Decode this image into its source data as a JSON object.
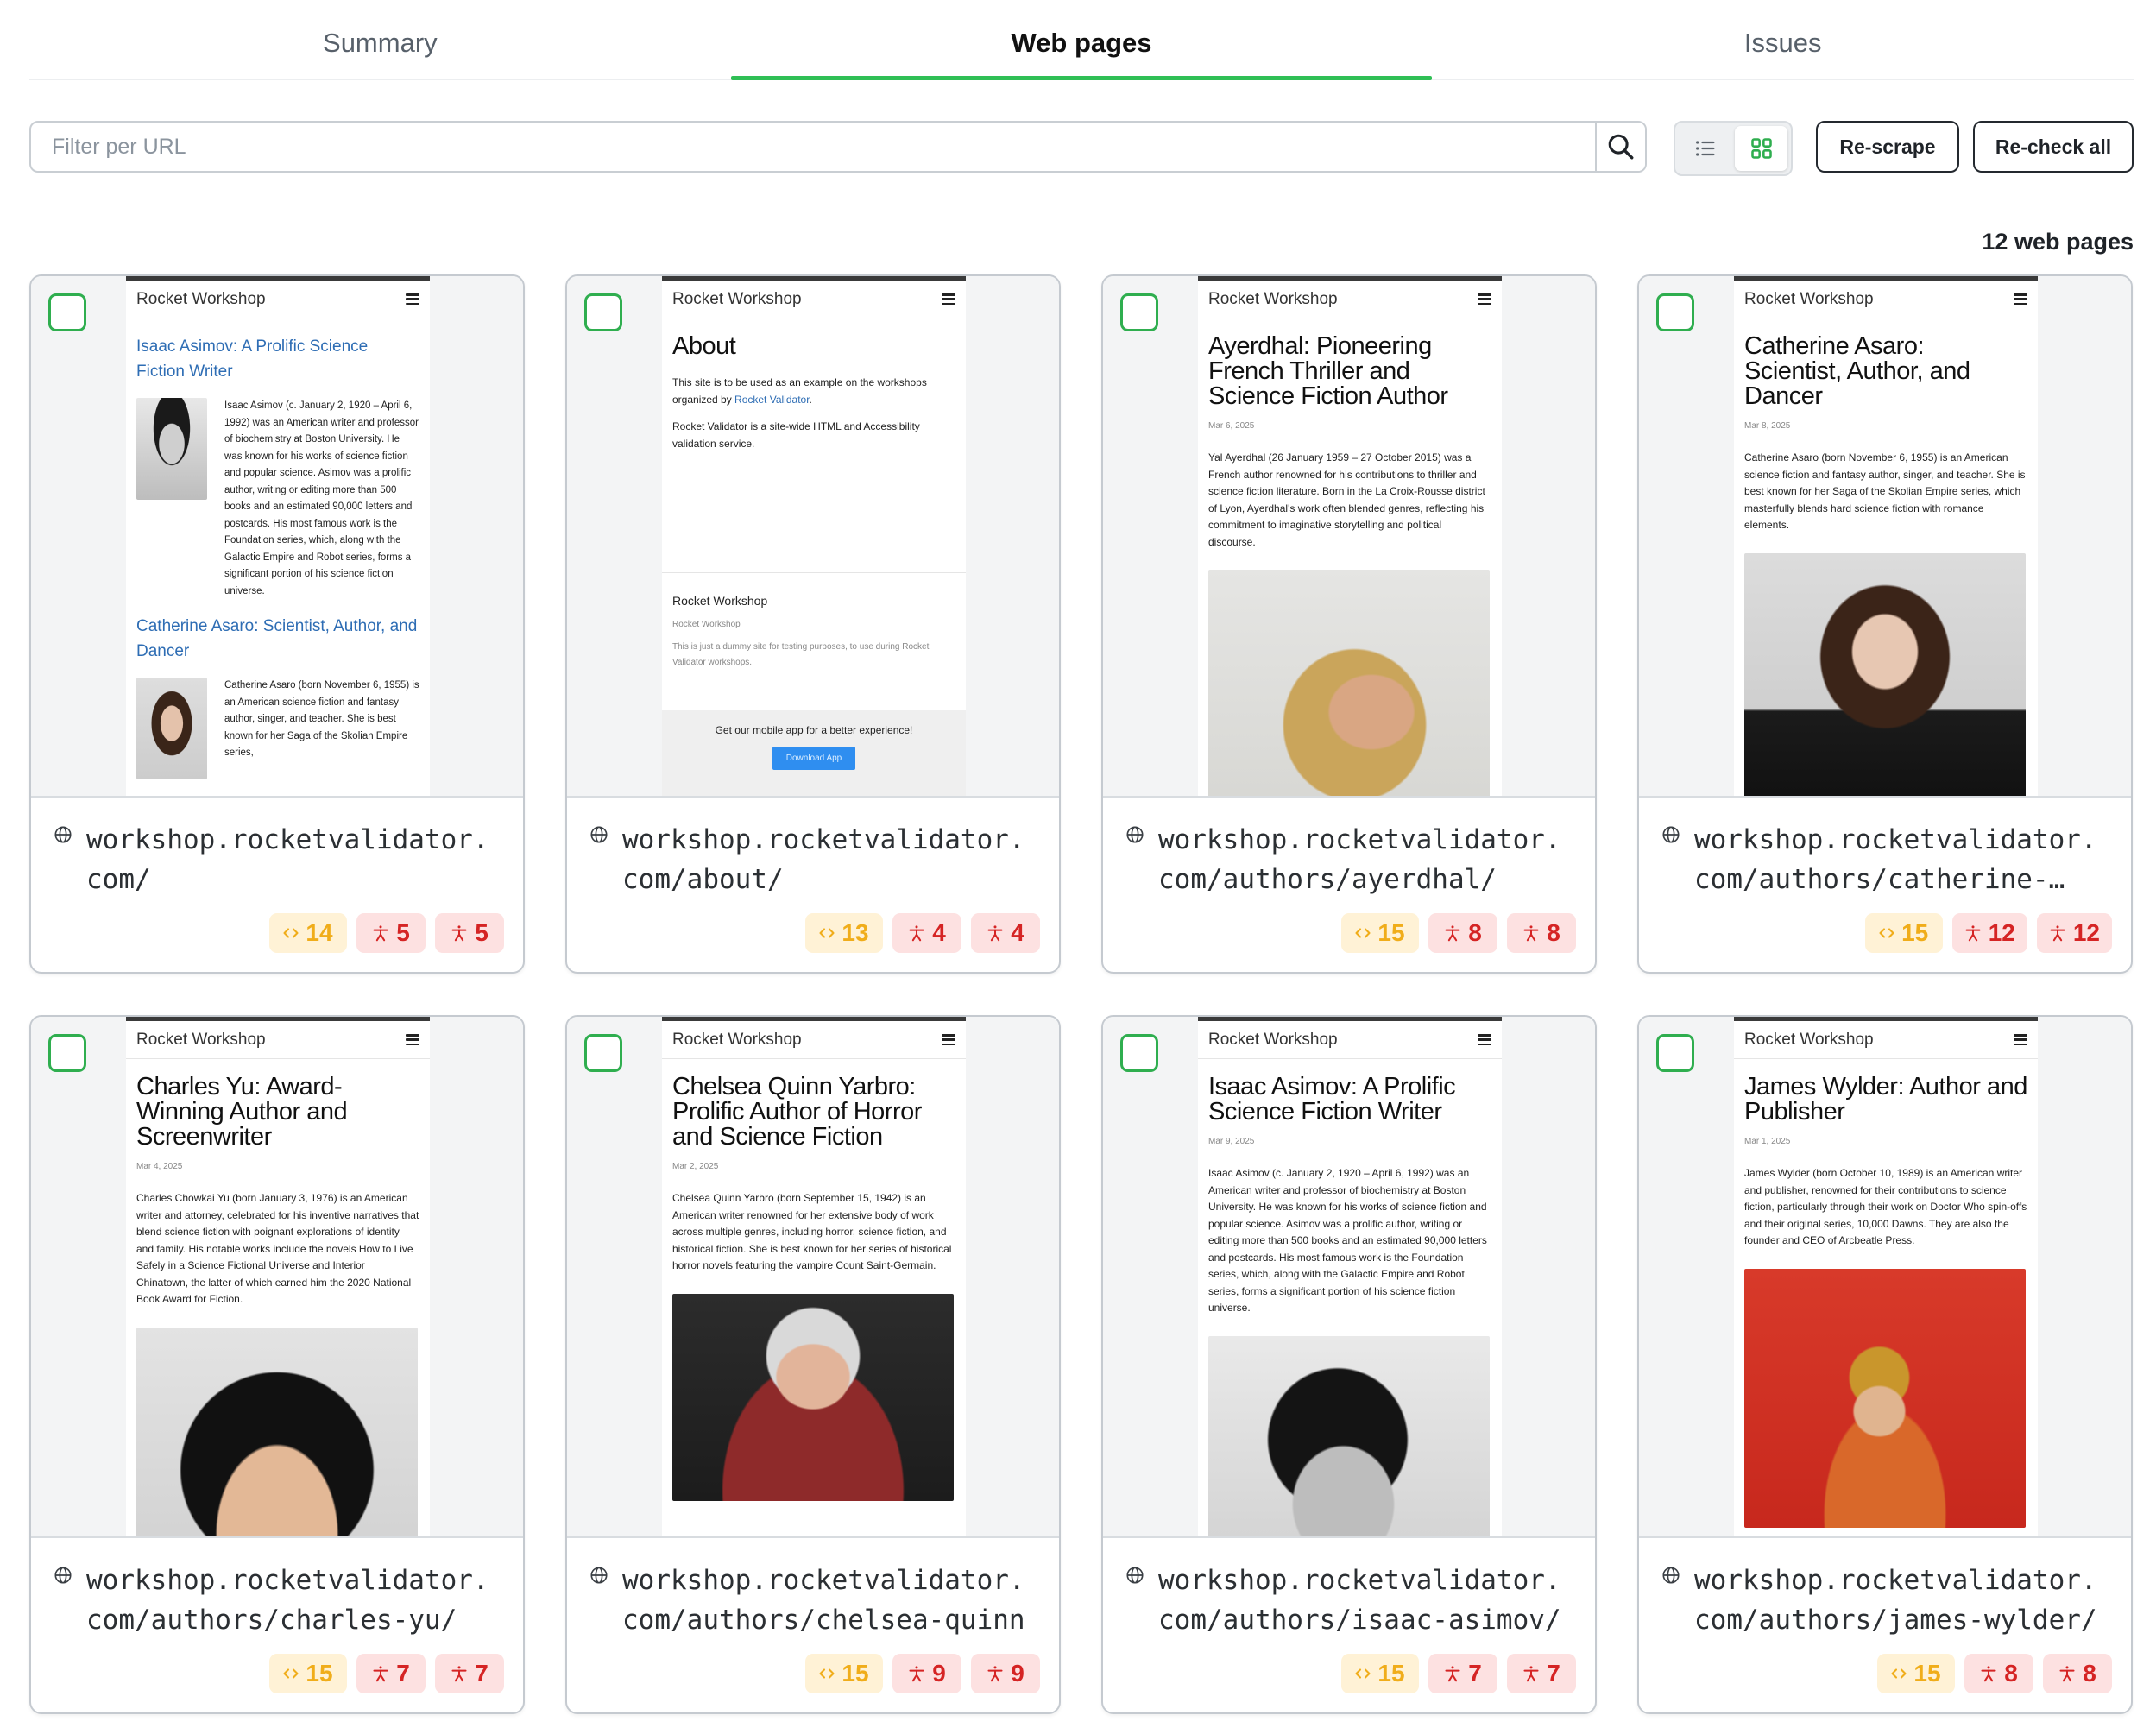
{
  "tabs": [
    {
      "label": "Summary"
    },
    {
      "label": "Web pages"
    },
    {
      "label": "Issues"
    }
  ],
  "toolbar": {
    "search_placeholder": "Filter per URL",
    "rescrape_label": "Re-scrape",
    "recheck_label": "Re-check all"
  },
  "page_count": "12 web pages",
  "colors": {
    "accent": "#2fbf55",
    "html_issue": "#f0ad1a",
    "a11y_issue": "#d52424"
  },
  "preview_site": {
    "brand": "Rocket Workshop",
    "home": {
      "item1_title": "Isaac Asimov: A Prolific Science Fiction Writer",
      "item1_text": "Isaac Asimov (c. January 2, 1920 – April 6, 1992) was an American writer and professor of biochemistry at Boston University. He was known for his works of science fiction and popular science. Asimov was a prolific author, writing or editing more than 500 books and an estimated 90,000 letters and postcards. His most famous work is the Foundation series, which, along with the Galactic Empire and Robot series, forms a significant portion of his science fiction universe.",
      "item2_title": "Catherine Asaro: Scientist, Author, and Dancer",
      "item2_text": "Catherine Asaro (born November 6, 1955) is an American science fiction and fantasy author, singer, and teacher. She is best known for her Saga of the Skolian Empire series,"
    },
    "about": {
      "title": "About",
      "p1_before": "This site is to be used as an example on the workshops organized by ",
      "p1_link": "Rocket Validator",
      "p1_after": ".",
      "p2": "Rocket Validator is a site-wide HTML and Accessibility validation service.",
      "footer_brand": "Rocket Workshop",
      "footer_small": "Rocket Workshop",
      "footer_text": "This is just a dummy site for testing purposes, to use during Rocket Validator workshops.",
      "app_text": "Get our mobile app for a better experience!",
      "app_button": "Download App"
    }
  },
  "cards": [
    {
      "url": "workshop.rocketvalidator.com/",
      "html": "14",
      "a11y1": "5",
      "a11y2": "5"
    },
    {
      "url": "workshop.rocketvalidator.com/about/",
      "html": "13",
      "a11y1": "4",
      "a11y2": "4"
    },
    {
      "url": "workshop.rocketvalidator.com/authors/ayerdhal/",
      "html": "15",
      "a11y1": "8",
      "a11y2": "8",
      "title": "Ayerdhal: Pioneering French Thriller and Science Fiction Author",
      "date": "Mar 6, 2025",
      "text": "Yal Ayerdhal (26 January 1959 – 27 October 2015) was a French author renowned for his contributions to thriller and science fiction literature. Born in the La Croix-Rousse district of Lyon, Ayerdhal's work often blended genres, reflecting his commitment to imaginative storytelling and political discourse."
    },
    {
      "url": "workshop.rocketvalidator.com/authors/catherine-…",
      "html": "15",
      "a11y1": "12",
      "a11y2": "12",
      "title": "Catherine Asaro: Scientist, Author, and Dancer",
      "date": "Mar 8, 2025",
      "text": "Catherine Asaro (born November 6, 1955) is an American science fiction and fantasy author, singer, and teacher. She is best known for her Saga of the Skolian Empire series, which masterfully blends hard science fiction with romance elements."
    },
    {
      "url": "workshop.rocketvalidator.com/authors/charles-yu/",
      "html": "15",
      "a11y1": "7",
      "a11y2": "7",
      "title": "Charles Yu: Award-Winning Author and Screenwriter",
      "date": "Mar 4, 2025",
      "text": "Charles Chowkai Yu (born January 3, 1976) is an American writer and attorney, celebrated for his inventive narratives that blend science fiction with poignant explorations of identity and family. His notable works include the novels How to Live Safely in a Science Fictional Universe and Interior Chinatown, the latter of which earned him the 2020 National Book Award for Fiction."
    },
    {
      "url": "workshop.rocketvalidator.com/authors/chelsea-quinn-…",
      "html": "15",
      "a11y1": "9",
      "a11y2": "9",
      "title": "Chelsea Quinn Yarbro: Prolific Author of Horror and Science Fiction",
      "date": "Mar 2, 2025",
      "text": "Chelsea Quinn Yarbro (born September 15, 1942) is an American writer renowned for her extensive body of work across multiple genres, including horror, science fiction, and historical fiction. She is best known for her series of historical horror novels featuring the vampire Count Saint-Germain."
    },
    {
      "url": "workshop.rocketvalidator.com/authors/isaac-asimov/",
      "html": "15",
      "a11y1": "7",
      "a11y2": "7",
      "title": "Isaac Asimov: A Prolific Science Fiction Writer",
      "date": "Mar 9, 2025",
      "text": "Isaac Asimov (c. January 2, 1920 – April 6, 1992) was an American writer and professor of biochemistry at Boston University. He was known for his works of science fiction and popular science. Asimov was a prolific author, writing or editing more than 500 books and an estimated 90,000 letters and postcards. His most famous work is the Foundation series, which, along with the Galactic Empire and Robot series, forms a significant portion of his science fiction universe."
    },
    {
      "url": "workshop.rocketvalidator.com/authors/james-wylder/",
      "html": "15",
      "a11y1": "8",
      "a11y2": "8",
      "title": "James Wylder: Author and Publisher",
      "date": "Mar 1, 2025",
      "text": "James Wylder (born October 10, 1989) is an American writer and publisher, renowned for their contributions to science fiction, particularly through their work on Doctor Who spin-offs and their original series, 10,000 Dawns. They are also the founder and CEO of Arcbeatle Press."
    }
  ]
}
